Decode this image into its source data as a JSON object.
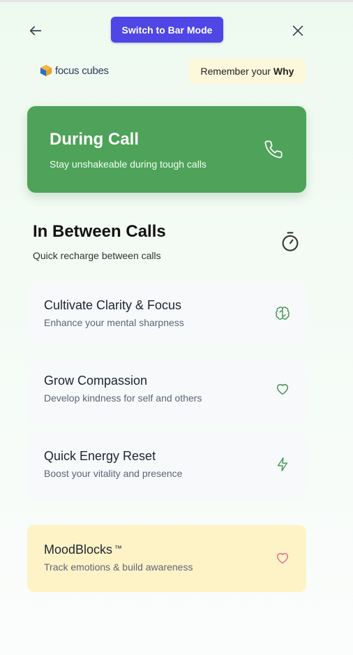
{
  "header": {
    "back_icon": "arrow-left-icon",
    "switch_button_label": "Switch to Bar Mode",
    "close_icon": "close-icon"
  },
  "brand": {
    "logo_text": "focus cubes",
    "colors": {
      "cube_top": "#f6b73c",
      "cube_side": "#2c6fbf",
      "cube_front": "#3d86d8"
    }
  },
  "why_pill": {
    "prefix": "Remember your",
    "emphasis": "Why"
  },
  "during_call": {
    "title": "During Call",
    "subtitle": "Stay unshakeable during tough calls",
    "icon": "phone-icon",
    "color": "#4fa259"
  },
  "in_between": {
    "title": "In Between Calls",
    "subtitle": "Quick recharge between calls",
    "icon": "stopwatch-icon",
    "items": [
      {
        "title": "Cultivate Clarity & Focus",
        "subtitle": "Enhance your mental sharpness",
        "icon": "brain-icon"
      },
      {
        "title": "Grow Compassion",
        "subtitle": "Develop kindness for self and others",
        "icon": "heart-icon"
      },
      {
        "title": "Quick Energy Reset",
        "subtitle": "Boost your vitality and presence",
        "icon": "lightning-icon"
      }
    ]
  },
  "moodblocks": {
    "title": "MoodBlocks",
    "trademark": "™",
    "subtitle": "Track emotions & build awareness",
    "icon": "heart-icon",
    "color": "#fef3c6"
  }
}
